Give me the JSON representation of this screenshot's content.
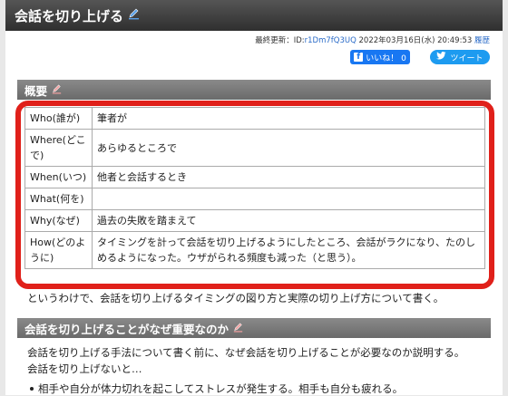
{
  "page": {
    "title": "会話を切り上げる",
    "meta": {
      "updated_label": "最終更新：",
      "id_label": "ID:",
      "id_value": "r1Dm7fQ3UQ",
      "datetime": "2022年03月16日(水) 20:49:53",
      "history_link": "履歴"
    },
    "social": {
      "like_label": "いいね！ 0",
      "tweet_label": "ツイート"
    }
  },
  "section1": {
    "heading": "概要",
    "rows": [
      {
        "key": "Who(誰が)",
        "value": "筆者が"
      },
      {
        "key": "Where(どこで)",
        "value": "あらゆるところで"
      },
      {
        "key": "When(いつ)",
        "value": "他者と会話するとき"
      },
      {
        "key": "What(何を)",
        "value": ""
      },
      {
        "key": "Why(なぜ)",
        "value": "過去の失敗を踏まえて"
      },
      {
        "key": "How(どのように)",
        "value": "タイミングを計って会話を切り上げるようにしたところ、会話がラクになり、たのしめるようになった。ウザがられる頻度も減った（と思う）。"
      }
    ],
    "after_text": "というわけで、会話を切り上げるタイミングの図り方と実際の切り上げ方について書く。"
  },
  "section2": {
    "heading": "会話を切り上げることがなぜ重要なのか",
    "para1": "会話を切り上げる手法について書く前に、なぜ会話を切り上げることが必要なのか説明する。",
    "para2": "会話を切り上げないと…",
    "bullet1": "相手や自分が体力切れを起こしてストレスが発生する。相手も自分も疲れる。"
  },
  "colors": {
    "highlight_border": "#e0201a",
    "link": "#2a6bc8",
    "facebook": "#1877f2",
    "twitter": "#1d9bf0"
  },
  "icons": [
    "edit-pencil-icon",
    "facebook-thumb-icon",
    "twitter-bird-icon"
  ]
}
